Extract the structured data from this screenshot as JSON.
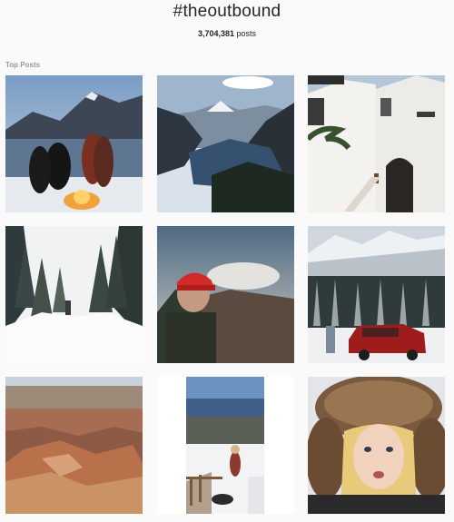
{
  "tag_page": {
    "hashtag": "#theoutbound",
    "post_count": "3,704,381",
    "post_count_suffix": " posts"
  },
  "sections": {
    "top_posts_label": "Top Posts"
  },
  "posts": [
    {
      "subject": "campfire-lake-mountains"
    },
    {
      "subject": "mountain-lake-valley"
    },
    {
      "subject": "white-stucco-building"
    },
    {
      "subject": "snowy-forest-trail"
    },
    {
      "subject": "man-red-cap-mountain"
    },
    {
      "subject": "snowy-mountain-red-suv"
    },
    {
      "subject": "canyon-landscape"
    },
    {
      "subject": "snowy-deck-hiker"
    },
    {
      "subject": "woman-fur-hat"
    }
  ],
  "colors": {
    "background": "#fafafa",
    "text": "#262626",
    "muted": "#999999"
  }
}
